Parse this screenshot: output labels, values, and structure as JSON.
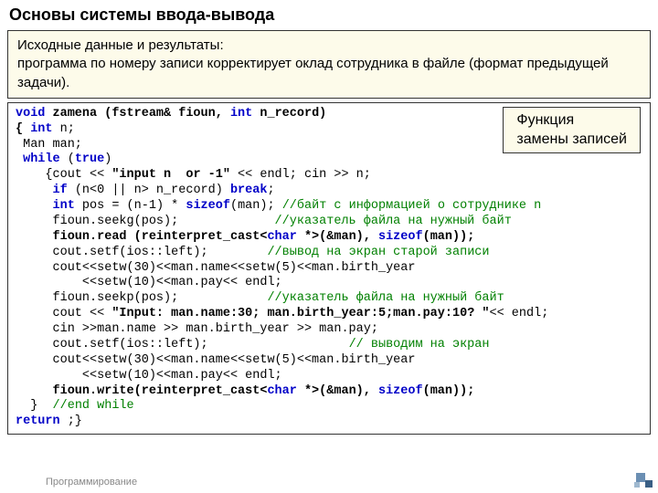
{
  "title": "Основы системы ввода-вывода",
  "intro": {
    "heading": "Исходные данные и результаты:",
    "body": "программа по номеру записи корректирует оклад сотрудника в файле (формат предыдущей задачи)."
  },
  "callout": {
    "line1": "Функция",
    "line2": "замены записей"
  },
  "code": {
    "l1a": "void",
    "l1b": " zamena (fstream& fioun, ",
    "l1c": "int",
    "l1d": " n_record)",
    "l2a": "{ ",
    "l2b": "int",
    "l2c": " n;",
    "l3": " Man man;",
    "l4a": " ",
    "l4b": "while",
    "l4c": " (",
    "l4d": "true",
    "l4e": ")",
    "l5a": "    {cout << ",
    "l5b": "\"input n  or -1\"",
    "l5c": " << endl; cin >> n;",
    "l6a": "     ",
    "l6b": "if",
    "l6c": " (n<0 || n> n_record) ",
    "l6d": "break",
    "l6e": ";",
    "l7a": "     ",
    "l7b": "int",
    "l7c": " pos = (n-1) * ",
    "l7d": "sizeof",
    "l7e": "(man); ",
    "l7f": "//байт с информацией о сотруднике n",
    "l8a": "     fioun.seekg(pos);             ",
    "l8b": "//указатель файла на нужный байт",
    "l9a": "     fioun.read (reinterpret_cast<",
    "l9b": "char",
    "l9c": " *>(&man), ",
    "l9d": "sizeof",
    "l9e": "(man));",
    "l10a": "     cout.setf(ios::left);        ",
    "l10b": "//вывод на экран старой записи",
    "l11": "     cout<<setw(30)<<man.name<<setw(5)<<man.birth_year",
    "l12": "         <<setw(10)<<man.pay<< endl;",
    "l13a": "     fioun.seekp(pos);            ",
    "l13b": "//указатель файла на нужный байт",
    "l14a": "     cout << ",
    "l14b": "\"Input: man.name:30; man.birth_year:5;man.pay:10? \"",
    "l14c": "<< endl;",
    "l15": "     cin >>man.name >> man.birth_year >> man.pay;",
    "l16a": "     cout.setf(ios::left);                   ",
    "l16b": "// выводим на экран",
    "l17": "     cout<<setw(30)<<man.name<<setw(5)<<man.birth_year",
    "l18": "         <<setw(10)<<man.pay<< endl;",
    "l19a": "     fioun.write(reinterpret_cast<",
    "l19b": "char",
    "l19c": " *>(&man), ",
    "l19d": "sizeof",
    "l19e": "(man));",
    "l20a": "  }  ",
    "l20b": "//end while",
    "l21a": "return",
    "l21b": " ;}"
  },
  "footer": "Программирование"
}
